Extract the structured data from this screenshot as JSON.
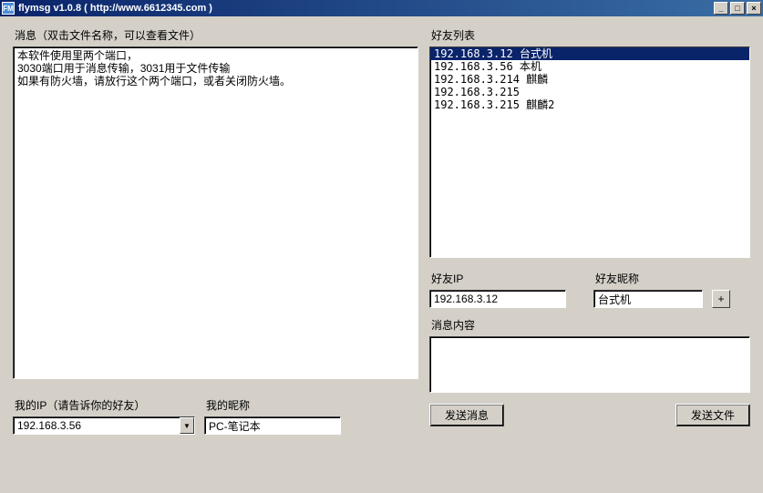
{
  "window": {
    "icon_text": "FM",
    "title": "flymsg v1.0.8  ( http://www.6612345.com )",
    "min": "_",
    "max": "□",
    "close": "×"
  },
  "left": {
    "messages_label": "消息（双击文件名称，可以查看文件）",
    "messages_text": "本软件使用里两个端口，\n3030端口用于消息传输，3031用于文件传输\n如果有防火墙，请放行这个两个端口，或者关闭防火墙。",
    "my_ip_label": "我的IP（请告诉你的好友）",
    "my_ip_value": "192.168.3.56",
    "my_nick_label": "我的昵称",
    "my_nick_value": "PC-笔记本"
  },
  "right": {
    "friends_label": "好友列表",
    "friends": [
      {
        "ip": "192.168.3.12",
        "name": "台式机",
        "selected": true
      },
      {
        "ip": "192.168.3.56",
        "name": "本机",
        "selected": false
      },
      {
        "ip": "192.168.3.214",
        "name": "麒麟",
        "selected": false
      },
      {
        "ip": "192.168.3.215",
        "name": "",
        "selected": false
      },
      {
        "ip": "192.168.3.215",
        "name": "麒麟2",
        "selected": false
      }
    ],
    "friend_ip_label": "好友IP",
    "friend_ip_value": "192.168.3.12",
    "friend_nick_label": "好友昵称",
    "friend_nick_value": "台式机",
    "add_btn": "+",
    "msg_content_label": "消息内容",
    "msg_content_value": "",
    "send_msg_btn": "发送消息",
    "send_file_btn": "发送文件"
  }
}
